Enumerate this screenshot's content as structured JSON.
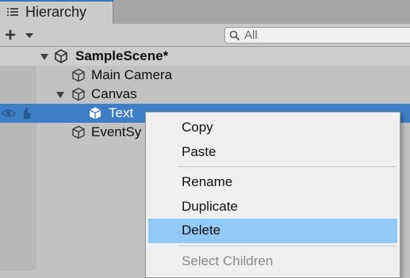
{
  "tab": {
    "title": "Hierarchy",
    "icon": "list-icon"
  },
  "toolbar": {
    "add_icon": "plus-icon",
    "add_dropdown_icon": "caret-down-icon",
    "search_placeholder": "All",
    "search_icon": "search-icon"
  },
  "hierarchy": {
    "scene": {
      "name": "SampleScene*",
      "expanded": true,
      "icon": "unity-scene-icon"
    },
    "items": [
      {
        "label": "Main Camera",
        "icon": "gameobject-cube-icon",
        "selected": false
      },
      {
        "label": "Canvas",
        "icon": "gameobject-cube-icon",
        "expanded": true,
        "selected": false
      },
      {
        "label": "Text",
        "icon": "gameobject-cube-icon",
        "selected": true
      },
      {
        "label": "EventSy",
        "icon": "gameobject-cube-icon",
        "selected": false
      }
    ]
  },
  "context_menu": {
    "items": [
      {
        "label": "Copy"
      },
      {
        "label": "Paste"
      },
      {
        "label": "Rename"
      },
      {
        "label": "Duplicate"
      },
      {
        "label": "Delete",
        "highlighted": true
      },
      {
        "label": "Select Children",
        "disabled": true
      }
    ]
  },
  "colors": {
    "selection": "#3d7ec7",
    "menu_highlight": "#91c9f7",
    "tab_accent": "#3a79bb",
    "panel_bg": "#c2c2c2"
  }
}
